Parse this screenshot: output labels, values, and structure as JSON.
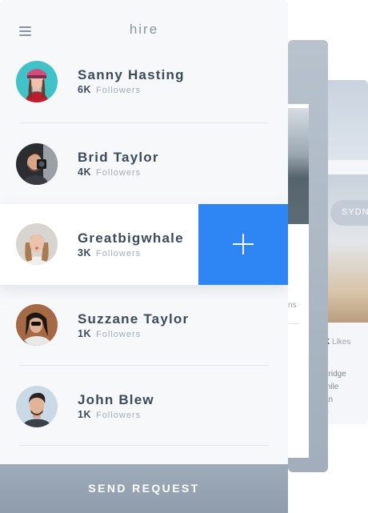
{
  "app": {
    "title": "hire"
  },
  "users": [
    {
      "name": "Sanny Hasting",
      "count": "6K",
      "followers_label": "Followers"
    },
    {
      "name": "Brid Taylor",
      "count": "4K",
      "followers_label": "Followers"
    },
    {
      "name": "Greatbigwhale",
      "count": "3K",
      "followers_label": "Followers"
    },
    {
      "name": "Suzzane Taylor",
      "count": "1K",
      "followers_label": "Followers"
    },
    {
      "name": "John Blew",
      "count": "1K",
      "followers_label": "Followers"
    }
  ],
  "action": {
    "send_label": "SEND REQUEST"
  },
  "background_card_2": {
    "partial_text": "ns"
  },
  "background_card_3": {
    "tag_label": "SYDN",
    "likes_count": "K",
    "likes_label": "Likes",
    "description_lines": [
      "bridge",
      "mile",
      "an"
    ],
    "more_label": "e"
  },
  "colors": {
    "accent": "#2e86f5",
    "text_dark": "#3c4a5a",
    "text_muted": "#a1acb8",
    "button_bar": "#97a4b3"
  },
  "icons": [
    "hamburger-menu-icon",
    "plus-icon",
    "user-icon"
  ]
}
